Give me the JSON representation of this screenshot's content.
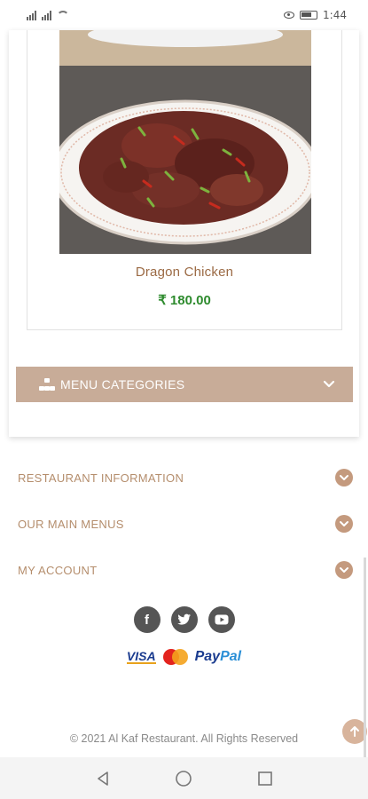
{
  "status_bar": {
    "time": "1:44",
    "signal_left_icons": [
      "signal-icon",
      "signal-icon",
      "wifi-icon"
    ],
    "right_icons": [
      "eye-icon",
      "battery-icon",
      "charging-icon"
    ]
  },
  "product": {
    "name": "Dragon Chicken",
    "price": "₹ 180.00",
    "image_icon": "dragon-chicken-photo"
  },
  "menu_categories": {
    "label": "MENU CATEGORIES",
    "icon": "sitemap-icon"
  },
  "footer": {
    "sections": [
      {
        "label": "RESTAURANT INFORMATION"
      },
      {
        "label": "OUR MAIN MENUS"
      },
      {
        "label": "MY ACCOUNT"
      }
    ],
    "social": [
      {
        "icon": "facebook-icon",
        "glyph": "f"
      },
      {
        "icon": "twitter-icon",
        "glyph": ""
      },
      {
        "icon": "youtube-icon",
        "glyph": ""
      }
    ],
    "payments": {
      "visa": "VISA",
      "paypal_a": "Pay",
      "paypal_b": "Pal"
    },
    "copyright": "© 2021 Al Kaf Restaurant. All Rights Reserved"
  },
  "colors": {
    "accent": "#c8ac98",
    "footer_text": "#b58e6d",
    "price": "#2e8b2e",
    "product_name": "#9b6a44"
  }
}
